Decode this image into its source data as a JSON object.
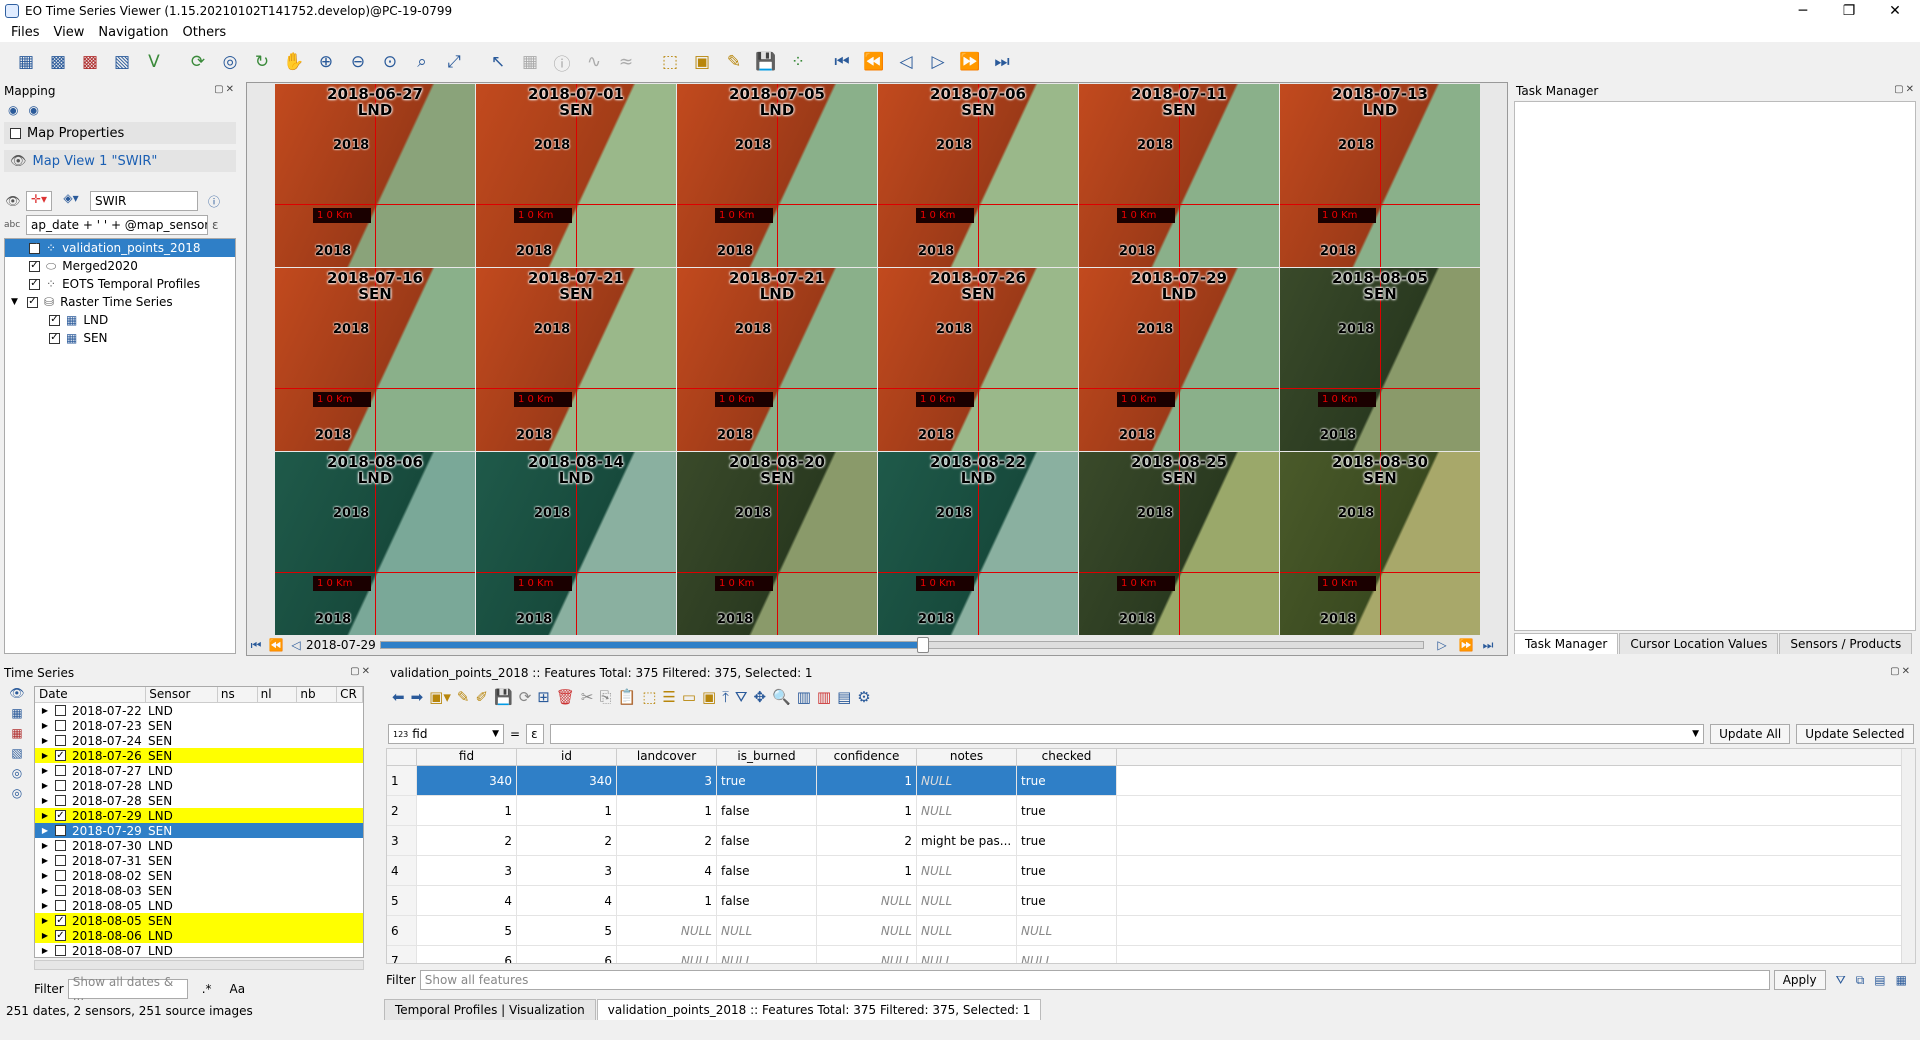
{
  "window": {
    "title": "EO Time Series Viewer (1.15.20210102T141752.develop)@PC-19-0799",
    "minimize": "─",
    "maximize": "❐",
    "close": "✕"
  },
  "menu": [
    "Files",
    "View",
    "Navigation",
    "Others"
  ],
  "mapping": {
    "title": "Mapping",
    "map_properties": "Map Properties",
    "map_view": "Map View 1 \"SWIR\"",
    "view_name": "SWIR",
    "expression": "ap_date + ' ' + @map_sensor",
    "layers": [
      {
        "label": "validation_points_2018",
        "checked": true,
        "selected": true
      },
      {
        "label": "Merged2020",
        "checked": true
      },
      {
        "label": "EOTS Temporal Profiles",
        "checked": true
      },
      {
        "label": "Raster Time Series",
        "checked": true
      },
      {
        "label": "LND",
        "checked": true
      },
      {
        "label": "SEN",
        "checked": true
      }
    ]
  },
  "map_tiles": [
    {
      "date": "2018-06-27",
      "sensor": "LND",
      "year": "2018",
      "scale": "1 0 Km"
    },
    {
      "date": "2018-07-01",
      "sensor": "SEN",
      "year": "2018",
      "scale": "1 0 Km"
    },
    {
      "date": "2018-07-05",
      "sensor": "LND",
      "year": "2018",
      "scale": "1 0 Km"
    },
    {
      "date": "2018-07-06",
      "sensor": "SEN",
      "year": "2018",
      "scale": "1 0 Km"
    },
    {
      "date": "2018-07-11",
      "sensor": "SEN",
      "year": "2018",
      "scale": "1 0 Km"
    },
    {
      "date": "2018-07-13",
      "sensor": "LND",
      "year": "2018",
      "scale": "1 0 Km"
    },
    {
      "date": "2018-07-16",
      "sensor": "SEN",
      "year": "2018",
      "scale": "1 0 Km"
    },
    {
      "date": "2018-07-21",
      "sensor": "SEN",
      "year": "2018",
      "scale": "1 0 Km"
    },
    {
      "date": "2018-07-21",
      "sensor": "LND",
      "year": "2018",
      "scale": "1 0 Km"
    },
    {
      "date": "2018-07-26",
      "sensor": "SEN",
      "year": "2018",
      "scale": "1 0 Km"
    },
    {
      "date": "2018-07-29",
      "sensor": "LND",
      "year": "2018",
      "scale": "1 0 Km"
    },
    {
      "date": "2018-08-05",
      "sensor": "SEN",
      "year": "2018",
      "scale": "1 0 Km"
    },
    {
      "date": "2018-08-06",
      "sensor": "LND",
      "year": "2018",
      "scale": "1 0 Km"
    },
    {
      "date": "2018-08-14",
      "sensor": "LND",
      "year": "2018",
      "scale": "1 0 Km"
    },
    {
      "date": "2018-08-20",
      "sensor": "SEN",
      "year": "2018",
      "scale": "1 0 Km"
    },
    {
      "date": "2018-08-22",
      "sensor": "LND",
      "year": "2018",
      "scale": "1 0 Km"
    },
    {
      "date": "2018-08-25",
      "sensor": "SEN",
      "year": "2018",
      "scale": "1 0 Km"
    },
    {
      "date": "2018-08-30",
      "sensor": "SEN",
      "year": "2018",
      "scale": "1 0 Km"
    }
  ],
  "time_slider": {
    "current_date": "2018-07-29",
    "position": 0.52
  },
  "task_manager": {
    "title": "Task Manager",
    "tabs": [
      "Task Manager",
      "Cursor Location Values",
      "Sensors / Products"
    ]
  },
  "time_series": {
    "title": "Time Series",
    "columns": [
      "Date",
      "Sensor",
      "ns",
      "nl",
      "nb",
      "CR"
    ],
    "rows": [
      {
        "date": "2018-07-22",
        "sensor": "LND",
        "checked": false,
        "state": ""
      },
      {
        "date": "2018-07-23",
        "sensor": "SEN",
        "checked": false,
        "state": ""
      },
      {
        "date": "2018-07-24",
        "sensor": "SEN",
        "checked": false,
        "state": ""
      },
      {
        "date": "2018-07-26",
        "sensor": "SEN",
        "checked": true,
        "state": "yellow"
      },
      {
        "date": "2018-07-27",
        "sensor": "LND",
        "checked": false,
        "state": ""
      },
      {
        "date": "2018-07-28",
        "sensor": "LND",
        "checked": false,
        "state": ""
      },
      {
        "date": "2018-07-28",
        "sensor": "SEN",
        "checked": false,
        "state": ""
      },
      {
        "date": "2018-07-29",
        "sensor": "LND",
        "checked": true,
        "state": "yellow"
      },
      {
        "date": "2018-07-29",
        "sensor": "SEN",
        "checked": false,
        "state": "selected"
      },
      {
        "date": "2018-07-30",
        "sensor": "LND",
        "checked": false,
        "state": ""
      },
      {
        "date": "2018-07-31",
        "sensor": "SEN",
        "checked": false,
        "state": ""
      },
      {
        "date": "2018-08-02",
        "sensor": "SEN",
        "checked": false,
        "state": ""
      },
      {
        "date": "2018-08-03",
        "sensor": "SEN",
        "checked": false,
        "state": ""
      },
      {
        "date": "2018-08-05",
        "sensor": "LND",
        "checked": false,
        "state": ""
      },
      {
        "date": "2018-08-05",
        "sensor": "SEN",
        "checked": true,
        "state": "yellow"
      },
      {
        "date": "2018-08-06",
        "sensor": "LND",
        "checked": true,
        "state": "yellow"
      },
      {
        "date": "2018-08-07",
        "sensor": "LND",
        "checked": false,
        "state": ""
      }
    ],
    "filter_label": "Filter",
    "filter_placeholder": "Show all dates & ...",
    "regex_label": ".*",
    "case_label": "Aa",
    "summary": "251 dates, 2 sensors, 251 source images"
  },
  "attribute_table": {
    "title": "validation_points_2018 :: Features Total: 375 Filtered: 375, Selected: 1",
    "field_select": "fid",
    "field_type_badge": "123",
    "equals": "=",
    "epsilon": "ε",
    "update_all": "Update All",
    "update_selected": "Update Selected",
    "columns": [
      "fid",
      "id",
      "landcover",
      "is_burned",
      "confidence",
      "notes",
      "checked"
    ],
    "rows": [
      {
        "n": "1",
        "fid": "340",
        "id": "340",
        "landcover": "3",
        "is_burned": "true",
        "confidence": "1",
        "notes": "NULL",
        "checked": "true",
        "selected": true
      },
      {
        "n": "2",
        "fid": "1",
        "id": "1",
        "landcover": "1",
        "is_burned": "false",
        "confidence": "1",
        "notes": "NULL",
        "checked": "true"
      },
      {
        "n": "3",
        "fid": "2",
        "id": "2",
        "landcover": "2",
        "is_burned": "false",
        "confidence": "2",
        "notes": "might be pas...",
        "checked": "true"
      },
      {
        "n": "4",
        "fid": "3",
        "id": "3",
        "landcover": "4",
        "is_burned": "false",
        "confidence": "1",
        "notes": "NULL",
        "checked": "true"
      },
      {
        "n": "5",
        "fid": "4",
        "id": "4",
        "landcover": "1",
        "is_burned": "false",
        "confidence": "NULL",
        "notes": "NULL",
        "checked": "true"
      },
      {
        "n": "6",
        "fid": "5",
        "id": "5",
        "landcover": "NULL",
        "is_burned": "NULL",
        "confidence": "NULL",
        "notes": "NULL",
        "checked": "NULL"
      },
      {
        "n": "7",
        "fid": "6",
        "id": "6",
        "landcover": "NULL",
        "is_burned": "NULL",
        "confidence": "NULL",
        "notes": "NULL",
        "checked": "NULL"
      }
    ],
    "filter_label": "Filter",
    "filter_placeholder": "Show all features",
    "apply": "Apply"
  },
  "bottom_tabs": [
    "Temporal Profiles | Visualization",
    "validation_points_2018 :: Features Total: 375 Filtered: 375, Selected: 1"
  ]
}
